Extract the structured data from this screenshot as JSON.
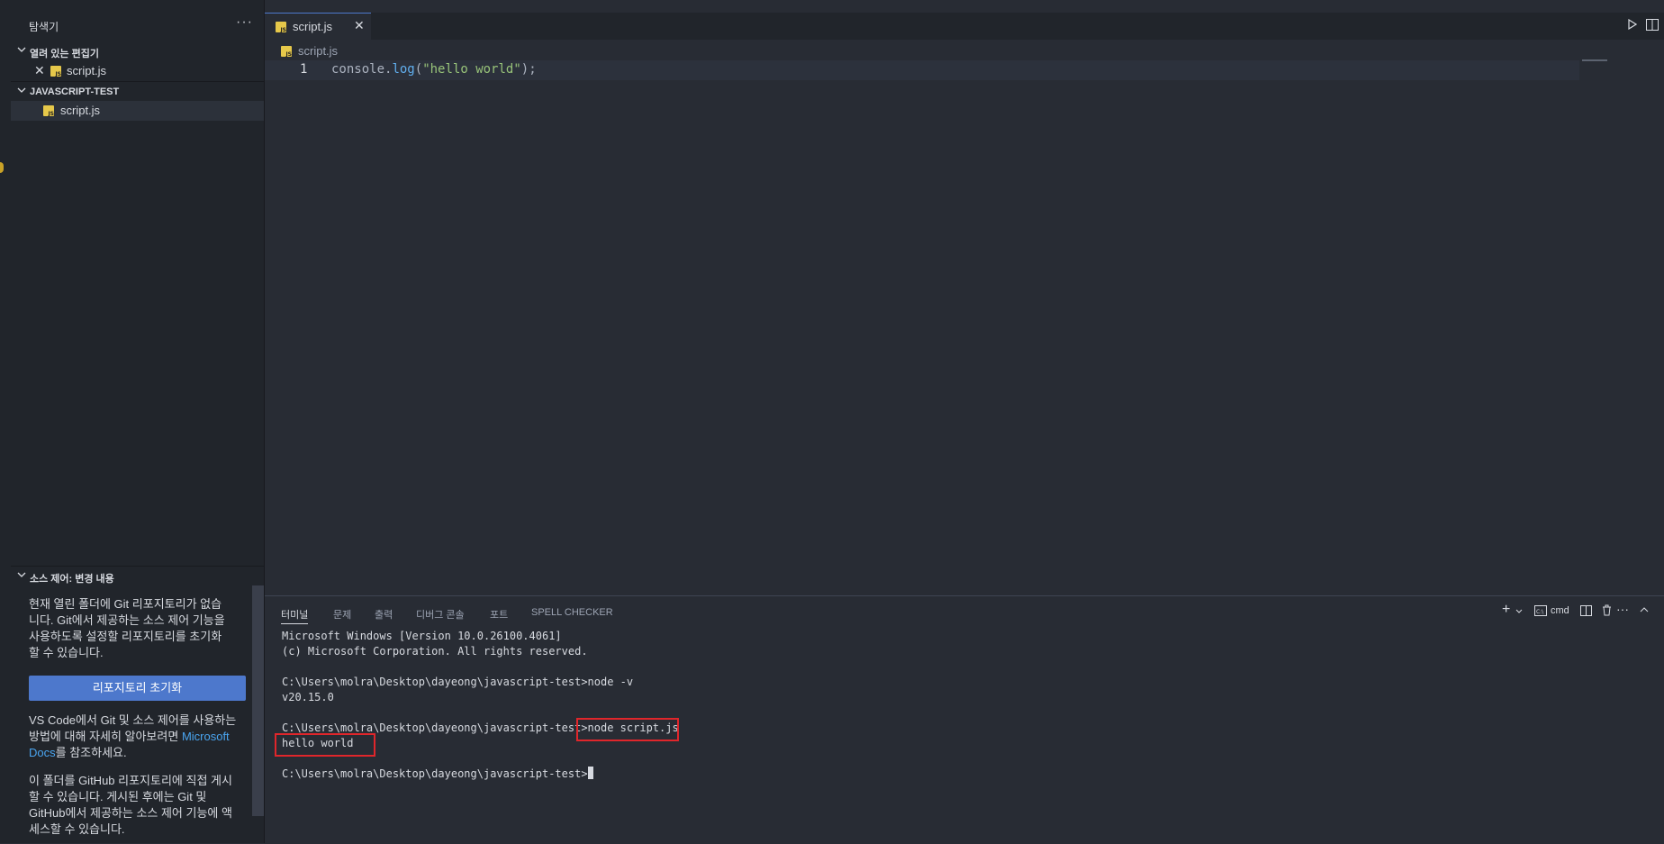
{
  "sidebar": {
    "title": "탐색기",
    "more": "···",
    "open_editors": {
      "label": "열려 있는 편집기",
      "items": [
        {
          "name": "script.js"
        }
      ]
    },
    "workspace": {
      "label": "JAVASCRIPT-TEST",
      "items": [
        {
          "name": "script.js"
        }
      ]
    },
    "source_control": {
      "label": "소스 제어: 변경 내용",
      "p1": [
        "현재 열린 폴더에 Git 리포지토리가 없습",
        "니다. Git에서 제공하는 소스 제어 기능을",
        "사용하도록 설정할 리포지토리를 초기화",
        "할 수 있습니다."
      ],
      "init_button": "리포지토리 초기화",
      "p2_line1": "VS Code에서 Git 및 소스 제어를 사용하는",
      "p2_line2_pre": "방법에 대해 자세히 알아보려면 ",
      "p2_link1": "Microsoft",
      "p2_link2": "Docs",
      "p2_line3_post": "를 참조하세요.",
      "p3": [
        "이 폴더를 GitHub 리포지토리에 직접 게시",
        "할 수 있습니다. 게시된 후에는 Git 및",
        "GitHub에서 제공하는 소스 제어 기능에 액",
        "세스할 수 있습니다."
      ]
    }
  },
  "editor": {
    "tab": {
      "name": "script.js"
    },
    "breadcrumb": "script.js",
    "lines": [
      {
        "num": "1",
        "obj": "console",
        "dot": ".",
        "fn": "log",
        "open": "(",
        "str": "\"hello world\"",
        "close": ");"
      }
    ]
  },
  "panel": {
    "tabs": [
      "터미널",
      "문제",
      "출력",
      "디버그 콘솔",
      "포트",
      "SPELL CHECKER"
    ],
    "shell_label": "cmd",
    "terminal": [
      "Microsoft Windows [Version 10.0.26100.4061]",
      "(c) Microsoft Corporation. All rights reserved.",
      "",
      "C:\\Users\\molra\\Desktop\\dayeong\\javascript-test>node -v",
      "v20.15.0",
      "",
      "C:\\Users\\molra\\Desktop\\dayeong\\javascript-test>node script.js",
      "hello world",
      "",
      "C:\\Users\\molra\\Desktop\\dayeong\\javascript-test>"
    ]
  },
  "colors": {
    "accent": "#4d78cc",
    "highlight_box": "#e0262b",
    "js_icon": "#e6c84a"
  }
}
